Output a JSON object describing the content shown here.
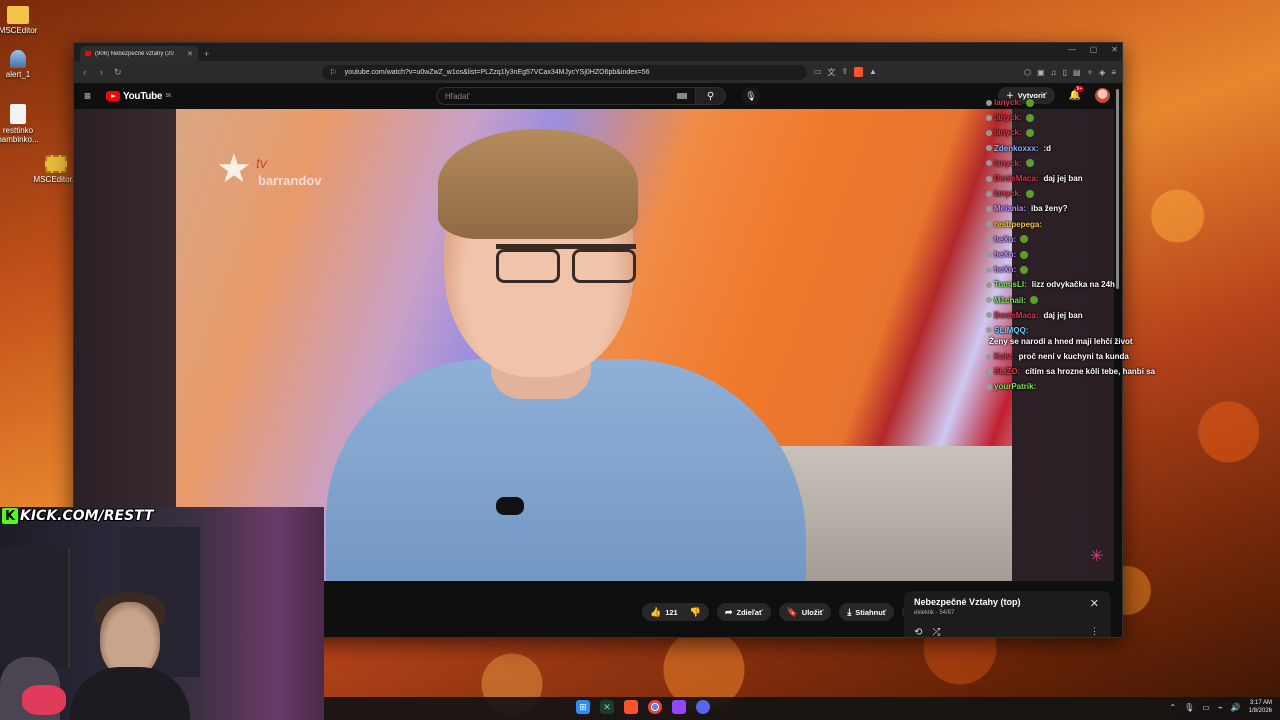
{
  "desktop": {
    "icons": [
      {
        "label": "MSCEditor",
        "icon": "folder-icon"
      },
      {
        "label": "alert_1",
        "icon": "user-icon"
      },
      {
        "label": "resttinko bambinko...",
        "icon": "file-icon"
      },
      {
        "label": "MSCEditor...",
        "icon": "zip-icon"
      }
    ]
  },
  "browser": {
    "tab_title": "(906) Nebezpečné vztahy (20",
    "url": "youtube.com/watch?v=u0wZwZ_w1os&list=PLZzq1ly3nEg57VCax34MJycYSj0HZO6pb&index=56"
  },
  "youtube": {
    "logo_text": "YouTube",
    "logo_country": "SK",
    "search_placeholder": "Hľadať",
    "create_label": "Vytvoriť",
    "notification_count": "9+",
    "channel_watermark": "barrandov",
    "channel_watermark_tv": "tv",
    "actions": {
      "likes": "121",
      "share": "Zdieľať",
      "save": "Uložiť",
      "download": "Stiahnuť"
    },
    "playlist": {
      "title": "Nebezpečné Vztahy (top)",
      "subtitle": "eklektik · 54/87"
    }
  },
  "chat": [
    {
      "user": "lanyck:",
      "msg": "",
      "color": "#d9334a",
      "check": true
    },
    {
      "user": "lanyck:",
      "msg": "",
      "color": "#d9334a",
      "check": true
    },
    {
      "user": "lanyck:",
      "msg": "",
      "color": "#d9334a",
      "check": true
    },
    {
      "user": "Zdenkoxxx:",
      "msg": ":d",
      "color": "#8ab4ff",
      "check": false
    },
    {
      "user": "lanyck:",
      "msg": "",
      "color": "#d9334a",
      "check": true
    },
    {
      "user": "DenisMaca:",
      "msg": "daj jej ban",
      "color": "#d9334a",
      "check": false
    },
    {
      "user": "lanyck:",
      "msg": "",
      "color": "#d9334a",
      "check": true
    },
    {
      "user": "Melania:",
      "msg": "iba ženy?",
      "color": "#c08aff",
      "check": false
    },
    {
      "user": "resttpepega:",
      "msg": "",
      "color": "#f5c542",
      "check": false
    },
    {
      "user": "heXn:",
      "msg": "",
      "color": "#c08aff",
      "check": true
    },
    {
      "user": "heXn:",
      "msg": "",
      "color": "#c08aff",
      "check": true
    },
    {
      "user": "heXn:",
      "msg": "",
      "color": "#c08aff",
      "check": true
    },
    {
      "user": "TomisLI:",
      "msg": "lizz odvykačka na 24h",
      "color": "#7ee05a",
      "check": false
    },
    {
      "user": "M1chail:",
      "msg": "",
      "color": "#7ee05a",
      "check": true
    },
    {
      "user": "DenisMaca:",
      "msg": "daj jej ban",
      "color": "#d9334a",
      "check": false
    },
    {
      "user": "SLIMQQ:",
      "msg": "Ženy se narodí a hned mají lehčí život",
      "color": "#6ad0ff",
      "check": false,
      "wrap": true
    },
    {
      "user": "Kaiv:",
      "msg": "proč není v kuchyni ta kunda",
      "color": "#d9334a",
      "check": false
    },
    {
      "user": "SLIZO:",
      "msg": "cítim sa hrozne kôli tebe, hanbi sa",
      "color": "#d9334a",
      "check": false
    },
    {
      "user": "yourPatrik:",
      "msg": "",
      "color": "#7ee05a",
      "check": false
    }
  ],
  "overlay": {
    "kick_banner": "KICK.COM/RESTT"
  },
  "taskbar": {
    "time": "3:17 AM",
    "date": "1/8/2026"
  }
}
